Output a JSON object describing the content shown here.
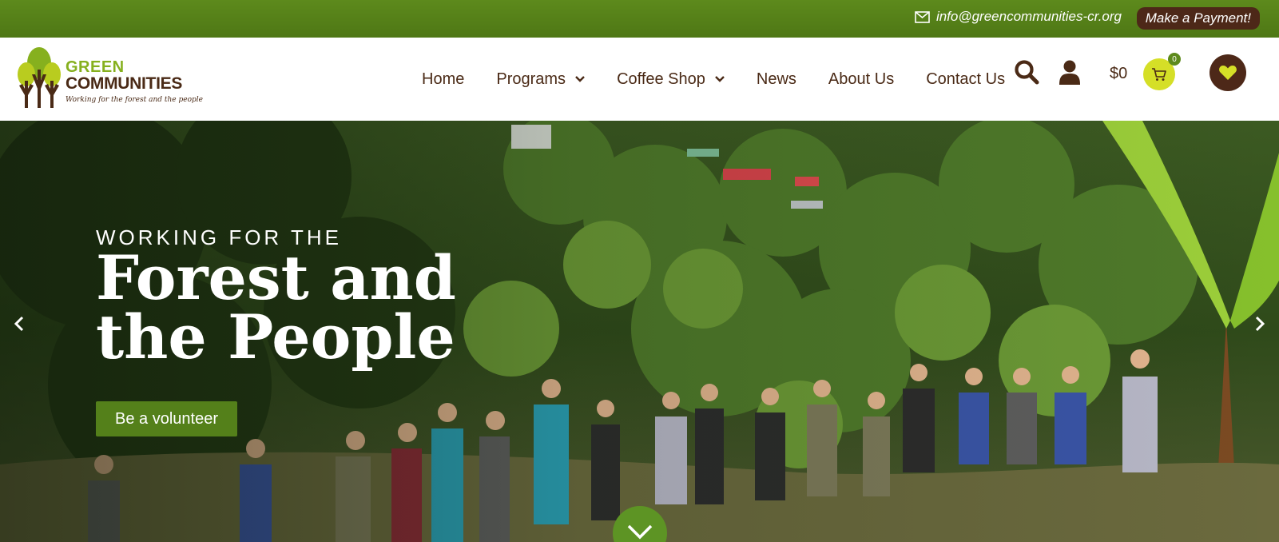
{
  "topbar": {
    "email": "info@greencommunities-cr.org",
    "payment_label": "Make a Payment!",
    "mail_icon": "envelope-icon",
    "color": "#5d8a1c"
  },
  "logo": {
    "line1": "GREEN",
    "line2": "COMMUNITIES",
    "tagline": "Working for the forest and the people"
  },
  "nav": {
    "items": [
      {
        "label": "Home"
      },
      {
        "label": "Programs",
        "has_dropdown": true
      },
      {
        "label": "Coffee Shop",
        "has_dropdown": true
      },
      {
        "label": "News"
      },
      {
        "label": "About Us"
      },
      {
        "label": "Contact Us"
      }
    ]
  },
  "header_tools": {
    "search_icon": "search-icon",
    "account_icon": "user-icon",
    "cart_total": "$0",
    "cart_count": "0",
    "cart_icon": "cart-icon",
    "wishlist_icon": "heart-icon"
  },
  "hero": {
    "eyebrow": "WORKING FOR THE",
    "headline_line1": "Forest and",
    "headline_line2": "the People",
    "cta_label": "Be a volunteer",
    "prev_icon": "chevron-left-icon",
    "next_icon": "chevron-right-icon",
    "scroll_icon": "chevron-down-icon"
  },
  "colors": {
    "brand_green": "#5d8a1c",
    "brand_brown": "#4d2818",
    "accent_yellow": "#d5df27",
    "text_brown": "#4a2a16"
  }
}
